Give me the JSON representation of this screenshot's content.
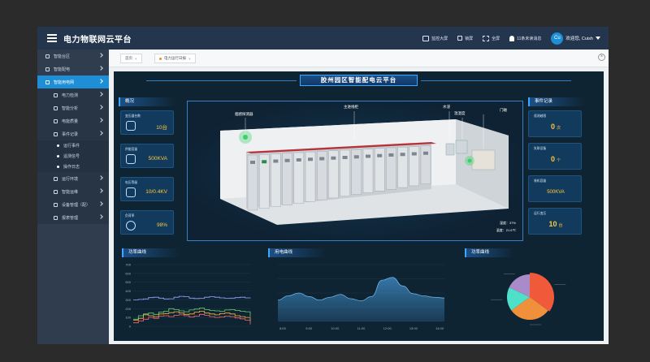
{
  "app": {
    "title": "电力物联网云平台"
  },
  "topbar": {
    "items": [
      {
        "icon": "monitor-icon",
        "label": "监控大屏"
      },
      {
        "icon": "lock-icon",
        "label": "锁屏"
      },
      {
        "icon": "fullscreen-icon",
        "label": "全屏"
      },
      {
        "icon": "bell-icon",
        "label": "11条未读消息"
      }
    ],
    "avatar": "Cu",
    "welcome": "欢迎您, Cuish"
  },
  "sidebar": {
    "items": [
      {
        "label": "智能台区",
        "level": 0,
        "icon": "district-icon",
        "chevron": true
      },
      {
        "label": "智能配电",
        "level": 0,
        "icon": "distribution-icon",
        "chevron": true
      },
      {
        "label": "智能用电网",
        "level": 0,
        "icon": "grid-icon",
        "chevron": true,
        "active": true
      },
      {
        "label": "电力检测",
        "level": 1,
        "icon": "detect-icon",
        "chevron": true
      },
      {
        "label": "智能分析",
        "level": 1,
        "icon": "analysis-icon",
        "chevron": true
      },
      {
        "label": "电能质量",
        "level": 1,
        "icon": "quality-icon",
        "chevron": true
      },
      {
        "label": "事件记录",
        "level": 1,
        "icon": "record-icon",
        "chevron": true
      },
      {
        "label": "运行事件",
        "level": 2
      },
      {
        "label": "遥测信号",
        "level": 2
      },
      {
        "label": "操作日志",
        "level": 2
      },
      {
        "label": "运行环境",
        "level": 1,
        "icon": "env-icon",
        "chevron": true
      },
      {
        "label": "智能运维",
        "level": 1,
        "icon": "ops-icon",
        "chevron": true
      },
      {
        "label": "设备管理（配）",
        "level": 1,
        "icon": "device-icon",
        "chevron": true
      },
      {
        "label": "报表管理",
        "level": 1,
        "icon": "report-icon",
        "chevron": true
      }
    ]
  },
  "tabs": [
    {
      "label": "首页",
      "close": "×"
    },
    {
      "label": "电力运行日报",
      "close": "×",
      "active": true
    }
  ],
  "dashboard": {
    "title": "胶州园区智能配电云平台",
    "overview_label": "概况",
    "stats": [
      {
        "label": "变压器台数",
        "value": "10台",
        "icon": "transformer-icon"
      },
      {
        "label": "供能容量",
        "value": "500KVA",
        "icon": "layers-icon"
      },
      {
        "label": "电压等级",
        "value": "10/0.4KV",
        "icon": "voltage-icon"
      },
      {
        "label": "负荷率",
        "value": "98%",
        "icon": "gauge-icon"
      }
    ],
    "events_label": "事件记录",
    "events": [
      {
        "label": "遥测越限",
        "value": "0",
        "unit": "次"
      },
      {
        "label": "失联设备",
        "value": "0",
        "unit": "个"
      },
      {
        "label": "装机容量",
        "value": "500KVA",
        "unit": ""
      },
      {
        "label": "运行变压",
        "value": "10",
        "unit": "台"
      }
    ],
    "room_labels": {
      "smoke": "烟感探测器",
      "line": "主进线柜",
      "water": "水浸",
      "temp": "温湿度",
      "door": "门磁"
    },
    "env": {
      "humidity": "湿度：37%",
      "temperature": "温度：21.6℃"
    },
    "chart1_label": "功率曲线",
    "chart2_label": "用电曲线",
    "chart3_label": "功率曲线"
  },
  "chart_data": [
    {
      "type": "line",
      "title": "功率曲线",
      "y_ticks": [
        "700",
        "600",
        "500",
        "400",
        "300",
        "200",
        "100",
        "0"
      ],
      "ylim": [
        0,
        700
      ],
      "series": [
        {
          "color": "#a3a3ff",
          "values": [
            300,
            305,
            310,
            325,
            330,
            320,
            310,
            312,
            330,
            340,
            335,
            320,
            315,
            318,
            330,
            336,
            330,
            322,
            318,
            320,
            325,
            330,
            322,
            318
          ]
        },
        {
          "color": "#6bd06b",
          "values": [
            80,
            120,
            140,
            150,
            135,
            160,
            170,
            200,
            190,
            175,
            165,
            185,
            195,
            205,
            190,
            180,
            175,
            170,
            185,
            190,
            180,
            170,
            165,
            110
          ]
        },
        {
          "color": "#ffb347",
          "values": [
            70,
            90,
            130,
            120,
            110,
            140,
            145,
            155,
            165,
            150,
            135,
            140,
            160,
            170,
            150,
            140,
            130,
            145,
            150,
            140,
            120,
            110,
            100,
            60
          ]
        },
        {
          "color": "#ff6a6a",
          "values": [
            40,
            60,
            80,
            100,
            90,
            115,
            120,
            110,
            125,
            130,
            120,
            105,
            115,
            135,
            125,
            110,
            100,
            105,
            115,
            110,
            95,
            85,
            70,
            20
          ]
        }
      ]
    },
    {
      "type": "area",
      "title": "用电曲线",
      "x": [
        "8:00",
        "9:00",
        "10:00",
        "11:00",
        "12:00",
        "13:00",
        "14:00"
      ],
      "y_ticks": [
        "8",
        "6",
        "4",
        "2",
        "0"
      ],
      "ylim": [
        0,
        8
      ],
      "values": [
        3.0,
        3.6,
        4.0,
        3.5,
        3.0,
        3.4,
        3.8,
        3.2,
        2.9,
        3.5,
        5.8,
        6.2,
        5.0,
        3.9,
        3.6,
        3.4,
        3.3
      ],
      "color": "#3a7fb5"
    },
    {
      "type": "pie",
      "title": "功率曲线",
      "values": [
        35,
        30,
        17,
        18
      ],
      "colors": [
        "#f05a3a",
        "#f0903a",
        "#4ee0c8",
        "#a98bc9"
      ]
    }
  ]
}
